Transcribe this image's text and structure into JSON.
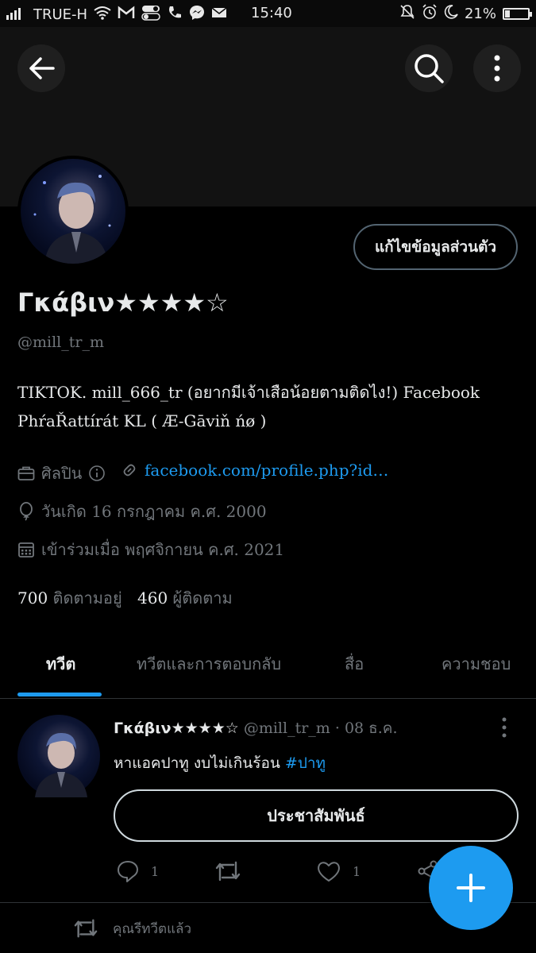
{
  "status_bar": {
    "carrier": "TRUE-H",
    "time": "15:40",
    "battery": "21%",
    "battery_level": 0.21
  },
  "profile": {
    "name": "Γκάβιν★★★★☆",
    "handle": "@mill_tr_m",
    "edit_label": "แก้ไขข้อมูลส่วนตัว",
    "bio_line1": "TIKTOK. mill_666_tr (อยากมีเจ้าเสือน้อยตามติดไง!) Facebook",
    "bio_line2": "PhŕaŘattírát KL ( Æ-Gāviň ńø )",
    "category": "ศิลปิน",
    "link": "facebook.com/profile.php?id…",
    "birthday": "วันเกิด 16 กรกฎาคม ค.ศ. 2000",
    "joined": "เข้าร่วมเมื่อ พฤศจิกายน ค.ศ. 2021",
    "following_count": "700",
    "following_label": "ติดตามอยู่",
    "followers_count": "460",
    "followers_label": "ผู้ติดตาม"
  },
  "tabs": [
    {
      "label": "ทวีต",
      "active": true
    },
    {
      "label": "ทวีตและการตอบกลับ",
      "active": false
    },
    {
      "label": "สื่อ",
      "active": false
    },
    {
      "label": "ความชอบ",
      "active": false
    }
  ],
  "tweet": {
    "name": "Γκάβιν★★★★☆",
    "handle": "@mill_tr_m",
    "dot": "·",
    "date": "08 ธ.ค.",
    "text": "หาแอคปาทู งบไม่เกินร้อน ",
    "hashtag": "#ปาทู",
    "button_label": "ประชาสัมพันธ์",
    "reply_count": "1",
    "like_count": "1"
  },
  "retweeted_label": "คุณรีทวีตแล้ว",
  "colors": {
    "accent": "#1d9bf0",
    "muted": "#71767b",
    "background": "#000000"
  }
}
